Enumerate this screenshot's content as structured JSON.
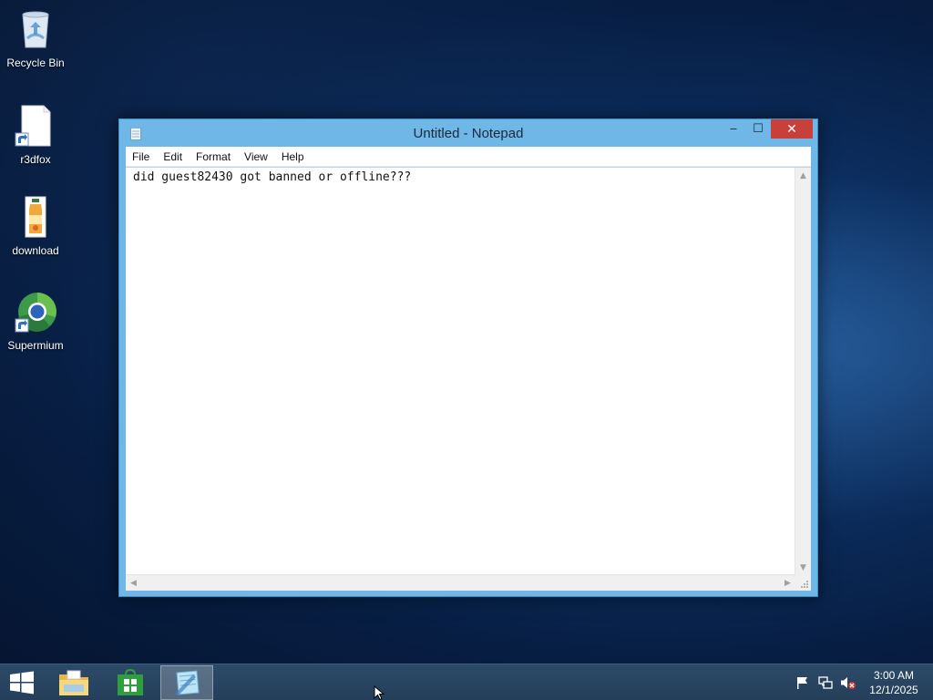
{
  "desktop": {
    "icons": [
      {
        "label": "Recycle Bin",
        "icon": "recycle-bin-icon"
      },
      {
        "label": "r3dfox",
        "icon": "file-shortcut-icon"
      },
      {
        "label": "download",
        "icon": "juice-bottle-icon"
      },
      {
        "label": "Supermium",
        "icon": "browser-globe-icon"
      }
    ]
  },
  "window": {
    "title": "Untitled - Notepad",
    "controls": {
      "minimize": "‒",
      "maximize": "☐",
      "close": "✕"
    },
    "menu": [
      "File",
      "Edit",
      "Format",
      "View",
      "Help"
    ],
    "content": "did guest82430 got banned or offline???"
  },
  "taskbar": {
    "apps": [
      "start-icon",
      "file-explorer-icon",
      "store-icon",
      "notepad-icon"
    ],
    "clock": {
      "time": "3:00 AM",
      "date": "12/1/2025"
    }
  },
  "colors": {
    "window_frame": "#6fb7e6",
    "close_button": "#c7413a",
    "taskbar": "#2c4a68",
    "desktop": "#0b2b5a"
  }
}
